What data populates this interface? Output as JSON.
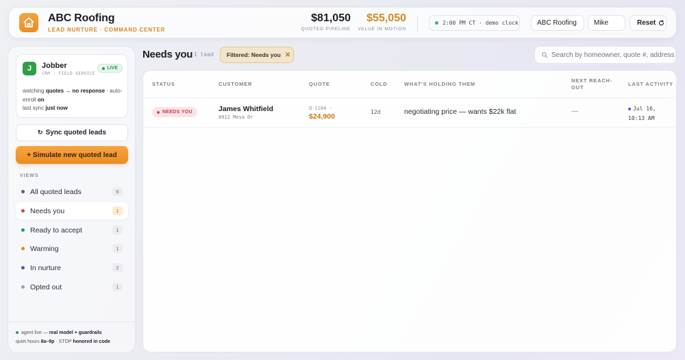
{
  "header": {
    "app_name": "ABC Roofing",
    "app_subtitle": "LEAD NURTURE · COMMAND CENTER",
    "logo_icon": "home-icon",
    "stats": {
      "pipeline_value": "$81,050",
      "pipeline_label": "QUOTED PIPELINE",
      "motion_value": "$55,050",
      "motion_label": "VALUE IN MOTION"
    },
    "clock_text": "2:00 PM CT · demo clock",
    "business_select": "ABC Roofing",
    "user_select": "Mike",
    "reset_label": "Reset",
    "reset_icon": "refresh-icon"
  },
  "sidebar": {
    "integration": {
      "logo_letter": "J",
      "name": "Jobber",
      "subtitle": "CRM · FIELD SERVICE",
      "status": "LIVE",
      "desc_prefix": "watching",
      "desc_strong1": "quotes → no response",
      "desc_mid": "· auto-enroll",
      "desc_strong2": "on",
      "desc_sync_prefix": "last sync",
      "desc_sync_strong": "just now"
    },
    "sync_button": "Sync quoted leads",
    "sync_icon": "sync-icon",
    "simulate_button": "+ Simulate new quoted lead",
    "views_heading": "VIEWS",
    "views": [
      {
        "label": "All quoted leads",
        "count": "6",
        "color": "#5b5f6b"
      },
      {
        "label": "Needs you",
        "count": "1",
        "color": "#e0404f",
        "active": true
      },
      {
        "label": "Ready to accept",
        "count": "1",
        "color": "#1f9a5c"
      },
      {
        "label": "Warming",
        "count": "1",
        "color": "#e08a1e"
      },
      {
        "label": "In nurture",
        "count": "2",
        "color": "#4a56c9"
      },
      {
        "label": "Opted out",
        "count": "1",
        "color": "#9aa0ab"
      }
    ],
    "footer": {
      "line1_prefix": "agent live —",
      "line1_strong": "real model + guardrails",
      "line2_prefix": "quiet hours",
      "line2_strong1": "8a–9p",
      "line2_mid": "· STOP",
      "line2_strong2": "honored in code"
    }
  },
  "main": {
    "title": "Needs you",
    "count_text": "1 lead",
    "filter_chip": "Filtered: Needs you",
    "filter_close": "✕",
    "search_placeholder": "Search by homeowner, quote #, address…",
    "columns": [
      "STATUS",
      "CUSTOMER",
      "QUOTE",
      "COLD",
      "WHAT'S HOLDING THEM",
      "NEXT REACH-OUT",
      "LAST ACTIVITY"
    ],
    "rows": [
      {
        "status": "NEEDS YOU",
        "customer": "James Whitfield",
        "address": "8912 Mesa Dr",
        "quote_id": "Q-1104 ·",
        "quote_amount": "$24,900",
        "cold": "12d",
        "holding": "negotiating price — wants $22k flat",
        "next": "—",
        "last_date": "Jul 16,",
        "last_time": "10:13 AM"
      }
    ]
  },
  "colors": {
    "accent_orange": "#ec8c23",
    "needs_you_red": "#e0404f",
    "live_green": "#2a9653"
  }
}
